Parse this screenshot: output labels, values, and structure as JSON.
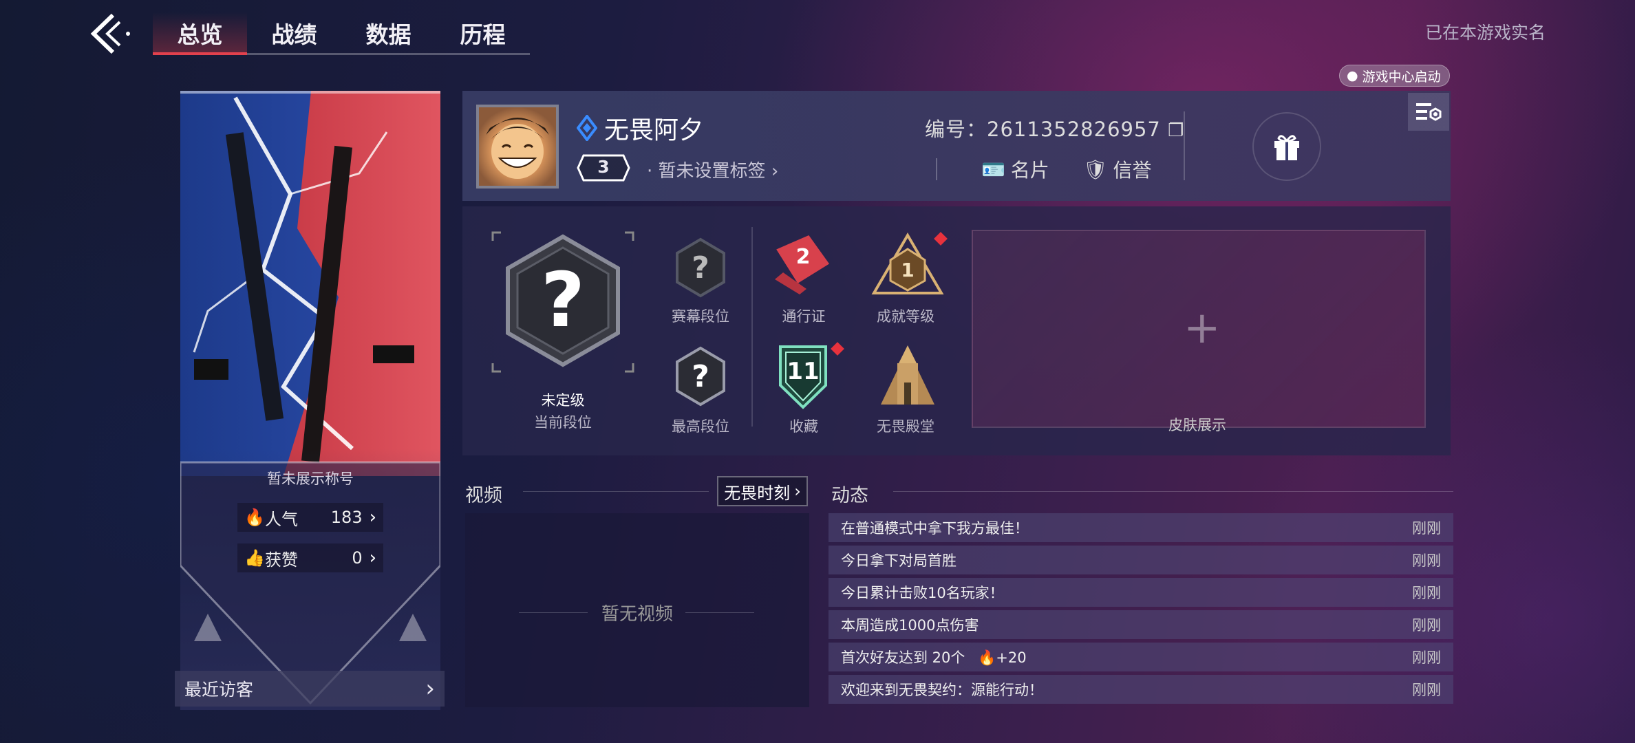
{
  "nav": {
    "tabs": [
      {
        "label": "总览",
        "active": true
      },
      {
        "label": "战绩",
        "active": false
      },
      {
        "label": "数据",
        "active": false
      },
      {
        "label": "历程",
        "active": false
      }
    ],
    "realname_text": "已在本游戏实名",
    "game_center_badge": "游戏中心启动"
  },
  "banner": {
    "title_text": "暂未展示称号",
    "popularity": {
      "label": "人气",
      "value": "183"
    },
    "likes": {
      "label": "获赞",
      "value": "0"
    },
    "recent_visitors": "最近访客"
  },
  "profile": {
    "nickname": "无畏阿夕",
    "level": "3",
    "tag_text": "暂未设置标签",
    "id_label": "编号：",
    "id_value": "2611352826957",
    "card_label": "名片",
    "credit_label": "信誉"
  },
  "ranks": {
    "current_name": "未定级",
    "current_label": "当前段位",
    "tournament_label": "赛幕段位",
    "highest_label": "最高段位",
    "pass_label": "通行证",
    "pass_value": "2",
    "achievement_label": "成就等级",
    "achievement_value": "1",
    "collection_label": "收藏",
    "collection_value": "11",
    "hall_label": "无畏殿堂",
    "skin_label": "皮肤展示"
  },
  "video": {
    "title": "视频",
    "button": "无畏时刻",
    "empty_text": "暂无视频"
  },
  "feed": {
    "title": "动态",
    "items": [
      {
        "text": "在普通模式中拿下我方最佳！",
        "time": "刚刚"
      },
      {
        "text": "今日拿下对局首胜",
        "time": "刚刚"
      },
      {
        "text": "今日累计击败10名玩家！",
        "time": "刚刚"
      },
      {
        "text": "本周造成1000点伤害",
        "time": "刚刚"
      },
      {
        "text": "首次好友达到 20个",
        "bonus": "+20",
        "time": "刚刚"
      },
      {
        "text": "欢迎来到无畏契约：源能行动！",
        "time": "刚刚"
      }
    ]
  },
  "colors": {
    "accent_red": "#e2414d",
    "diamond_blue": "#3a8cff",
    "gold": "#d9b173"
  }
}
